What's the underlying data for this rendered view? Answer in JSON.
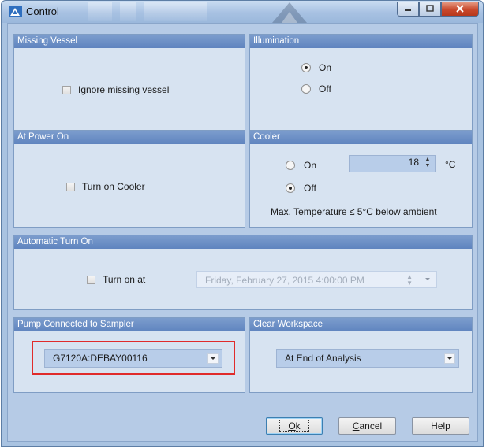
{
  "window": {
    "title": "Control"
  },
  "missing_vessel": {
    "header": "Missing Vessel",
    "ignore_label": "Ignore missing vessel"
  },
  "illumination": {
    "header": "Illumination",
    "on_label": "On",
    "off_label": "Off",
    "selected": "On"
  },
  "at_power_on": {
    "header": "At Power On",
    "turn_on_cooler_label": "Turn on Cooler"
  },
  "cooler": {
    "header": "Cooler",
    "on_label": "On",
    "off_label": "Off",
    "selected": "Off",
    "temp_value": "18",
    "unit": "°C",
    "note": "Max. Temperature ≤ 5°C below ambient"
  },
  "automatic_turn_on": {
    "header": "Automatic Turn On",
    "turn_on_at_label": "Turn on at",
    "datetime_value": "Friday, February 27, 2015  4:00:00 PM"
  },
  "pump": {
    "header": "Pump Connected to Sampler",
    "selected": "G7120A:DEBAY00116"
  },
  "clear_workspace": {
    "header": "Clear Workspace",
    "selected": "At End of Analysis"
  },
  "buttons": {
    "ok_mnemonic": "O",
    "ok_rest": "k",
    "cancel_mnemonic": "C",
    "cancel_rest": "ancel",
    "help": "Help"
  },
  "colors": {
    "highlight": "#e02b2b",
    "header": "#6a8cc4",
    "panel": "#d7e3f1"
  }
}
